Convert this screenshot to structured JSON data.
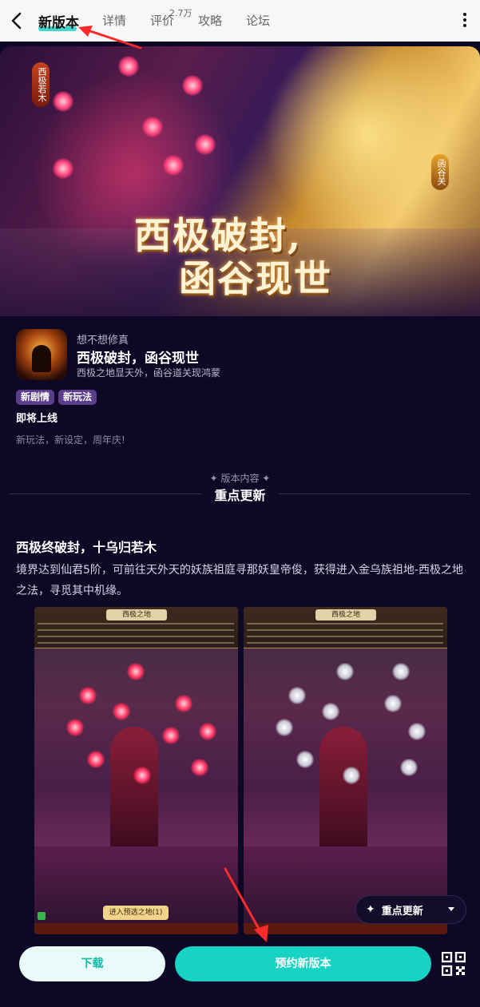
{
  "nav": {
    "tabs": [
      {
        "label": "新版本",
        "active": true
      },
      {
        "label": "详情"
      },
      {
        "label": "评价"
      },
      {
        "label": "攻略"
      },
      {
        "label": "论坛"
      }
    ],
    "review_count": "2.7万",
    "back_icon": "chevron-left-icon",
    "more_icon": "more-vertical-icon"
  },
  "banner": {
    "title_line1": "西极破封,",
    "title_line2": "函谷现世",
    "tag_left": "西极若木",
    "tag_right": "函谷关"
  },
  "app": {
    "developer": "想不想修真",
    "title": "西极破封，函谷现世",
    "subtitle": "西极之地显天外，函谷道关现鸿蒙",
    "tags": [
      "新剧情",
      "新玩法"
    ],
    "status": "即将上线",
    "description": "新玩法，新设定，周年庆!"
  },
  "section": {
    "label": "✦ 版本内容 ✦",
    "title": "重点更新"
  },
  "article": {
    "title": "西极终破封，十乌归若木",
    "body": "境界达到仙君5阶，可前往天外天的妖族祖庭寻那妖皇帝俊，获得进入金乌族祖地-西极之地之法，寻觅其中机缘。"
  },
  "screenshots": [
    {
      "header": "西极之地",
      "button": "进入预选之地(1)"
    },
    {
      "header": "西极之地",
      "button": ""
    }
  ],
  "floating": {
    "label": "重点更新",
    "icon": "sparkle-icon"
  },
  "bottom": {
    "download": "下载",
    "reserve": "预约新版本",
    "qr_icon": "qr-code-icon"
  },
  "colors": {
    "accent": "#17d3c3",
    "background": "#0d0826",
    "tag_bg": "#5c3d8c",
    "annotation": "#ff2a2a"
  }
}
